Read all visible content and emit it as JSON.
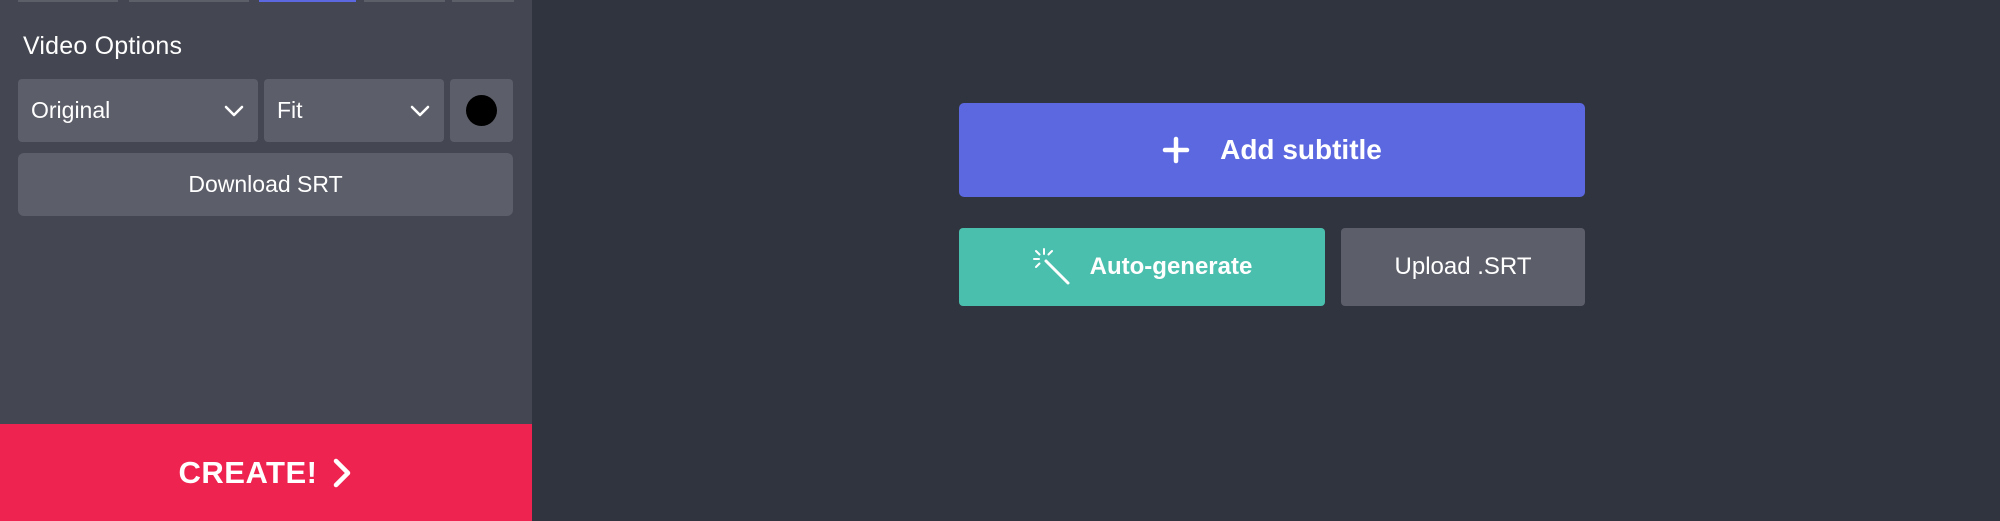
{
  "sidebar": {
    "section_title": "Video Options",
    "size_select": {
      "value": "Original",
      "icon": "chevron-down-icon"
    },
    "fit_select": {
      "value": "Fit",
      "icon": "chevron-down-icon"
    },
    "background_color": "#000000",
    "download_label": "Download SRT",
    "create_label": "CREATE!"
  },
  "main": {
    "add_subtitle_label": "Add subtitle",
    "auto_generate_label": "Auto-generate",
    "upload_label": "Upload .SRT"
  },
  "colors": {
    "sidebar_bg": "#444751",
    "main_bg": "#30343f",
    "accent_blue": "#5b68e0",
    "accent_green": "#4bbfad",
    "create_red": "#ef2350",
    "control_gray": "#5c5e69"
  }
}
